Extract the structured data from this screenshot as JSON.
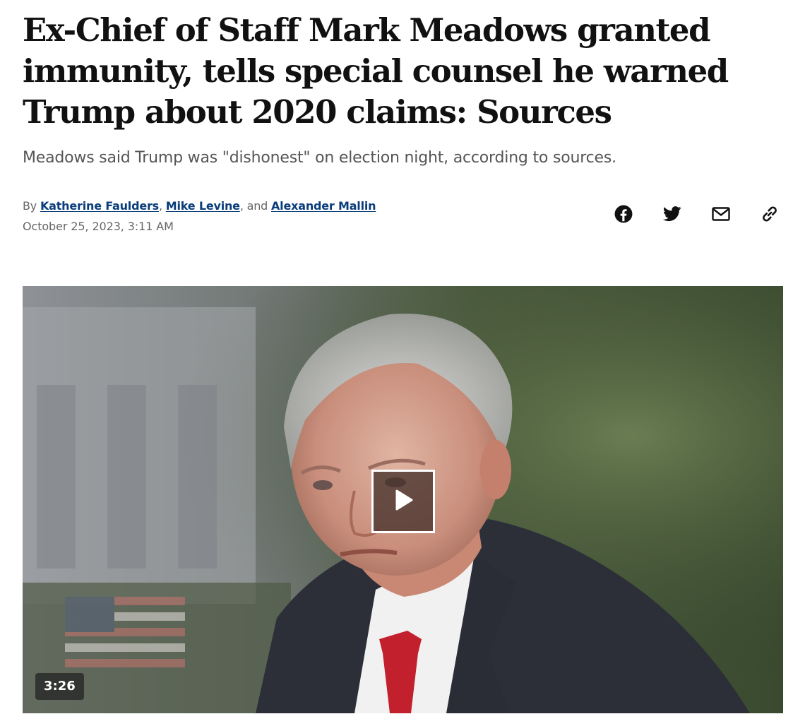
{
  "article": {
    "headline": "Ex-Chief of Staff Mark Meadows granted immunity, tells special counsel he warned Trump about 2020 claims: Sources",
    "subheadline": "Meadows said Trump was \"dishonest\" on election night, according to sources.",
    "byline": {
      "prefix": "By",
      "authors": [
        "Katherine Faulders",
        "Mike Levine",
        "Alexander Mallin"
      ],
      "separator": ",",
      "conjunction": ", and"
    },
    "date": "October 25, 2023, 3:11 AM"
  },
  "share": {
    "icons": [
      "facebook-icon",
      "twitter-icon",
      "email-icon",
      "link-icon"
    ]
  },
  "video": {
    "duration": "3:26",
    "play_icon": "play-icon"
  },
  "colors": {
    "author_link": "#0a3d7a",
    "headline": "#111111",
    "muted_text": "#666666"
  }
}
